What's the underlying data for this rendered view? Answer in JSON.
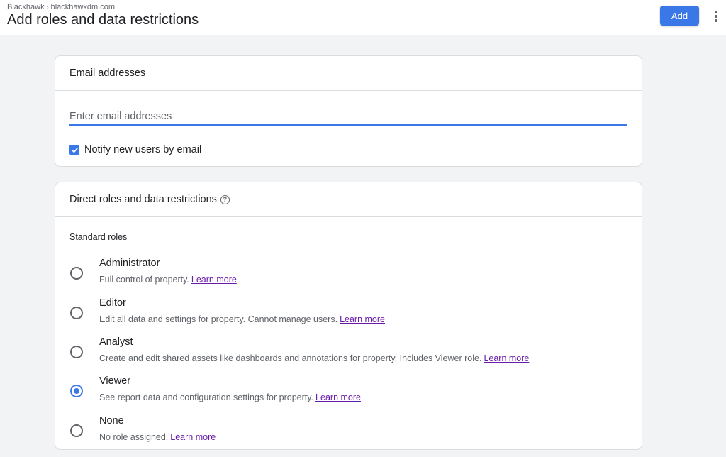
{
  "header": {
    "breadcrumb": [
      "Blackhawk",
      "blackhawkdm.com"
    ],
    "breadcrumb_separator": "›",
    "title": "Add roles and data restrictions",
    "add_label": "Add"
  },
  "email_card": {
    "title": "Email addresses",
    "input_placeholder": "Enter email addresses",
    "input_value": "",
    "notify_label": "Notify new users by email",
    "notify_checked": true
  },
  "roles_card": {
    "title": "Direct roles and data restrictions",
    "help_icon": "help-circle-icon",
    "section_label": "Standard roles",
    "learn_more": "Learn more",
    "selected": "Viewer",
    "roles": [
      {
        "name": "Administrator",
        "description": "Full control of property."
      },
      {
        "name": "Editor",
        "description": "Edit all data and settings for property. Cannot manage users."
      },
      {
        "name": "Analyst",
        "description": "Create and edit shared assets like dashboards and annotations for property. Includes Viewer role."
      },
      {
        "name": "Viewer",
        "description": "See report data and configuration settings for property."
      },
      {
        "name": "None",
        "description": "No role assigned."
      }
    ]
  },
  "colors": {
    "accent": "#3b78e7",
    "link": "#681da8",
    "background": "#f1f3f4"
  }
}
